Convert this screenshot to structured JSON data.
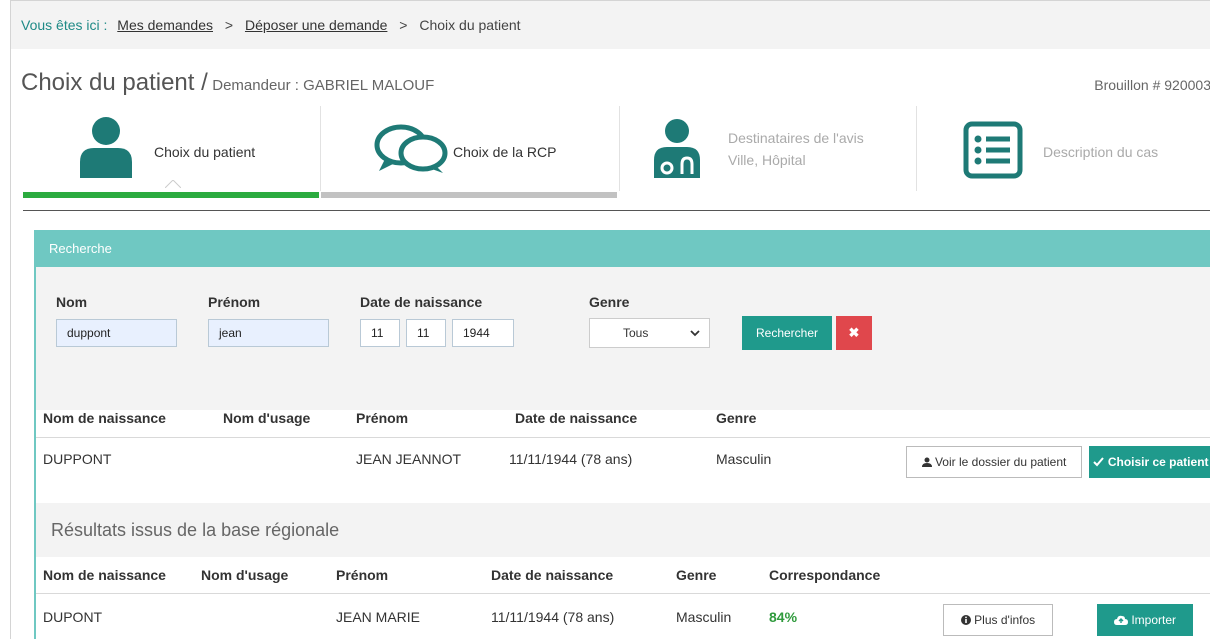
{
  "breadcrumb": {
    "prefix": "Vous êtes ici :",
    "items": [
      "Mes demandes",
      "Déposer une demande"
    ],
    "current": "Choix du patient",
    "separator": ">"
  },
  "header": {
    "title": "Choix du patient /",
    "requester": "Demandeur : GABRIEL MALOUF",
    "draft": "Brouillon # 920003"
  },
  "steps": [
    {
      "line1": "Choix du patient",
      "line2": "",
      "icon": "person-icon"
    },
    {
      "line1": "Choix de la RCP",
      "line2": "",
      "icon": "speech-bubbles-icon"
    },
    {
      "line1": "Destinataires de l'avis",
      "line2": "Ville, Hôpital",
      "icon": "doctor-icon"
    },
    {
      "line1": "Description du cas",
      "line2": "",
      "icon": "list-icon"
    }
  ],
  "search": {
    "title": "Recherche",
    "nom_label": "Nom",
    "nom_value": "duppont",
    "prenom_label": "Prénom",
    "prenom_value": "jean",
    "dob_label": "Date de naissance",
    "dob_day": "11",
    "dob_month": "11",
    "dob_year": "1944",
    "genre_label": "Genre",
    "genre_value": "Tous",
    "search_button": "Rechercher",
    "clear_button": "✖"
  },
  "results": {
    "columns": [
      "Nom de naissance",
      "Nom d'usage",
      "Prénom",
      "Date de naissance",
      "Genre"
    ],
    "rows": [
      {
        "nom": "DUPPONT",
        "usage": "",
        "prenom": "JEAN JEANNOT",
        "dob": "11/11/1944 (78 ans)",
        "genre": "Masculin",
        "view_button": "Voir le dossier du patient",
        "choose_button": "Choisir ce patient"
      }
    ]
  },
  "regional": {
    "title": "Résultats issus de la base régionale",
    "columns": [
      "Nom de naissance",
      "Nom d'usage",
      "Prénom",
      "Date de naissance",
      "Genre",
      "Correspondance"
    ],
    "rows": [
      {
        "nom": "DUPONT",
        "usage": "",
        "prenom": "JEAN MARIE",
        "dob": "11/11/1944 (78 ans)",
        "genre": "Masculin",
        "match": "84%",
        "info_button": "Plus d'infos",
        "import_button": "Importer"
      }
    ]
  },
  "colors": {
    "teal": "#1f7f7a",
    "accent_green": "#27a844",
    "panel_teal": "#6fc8c2",
    "button_teal": "#1f9a8c",
    "danger": "#e0474c"
  }
}
